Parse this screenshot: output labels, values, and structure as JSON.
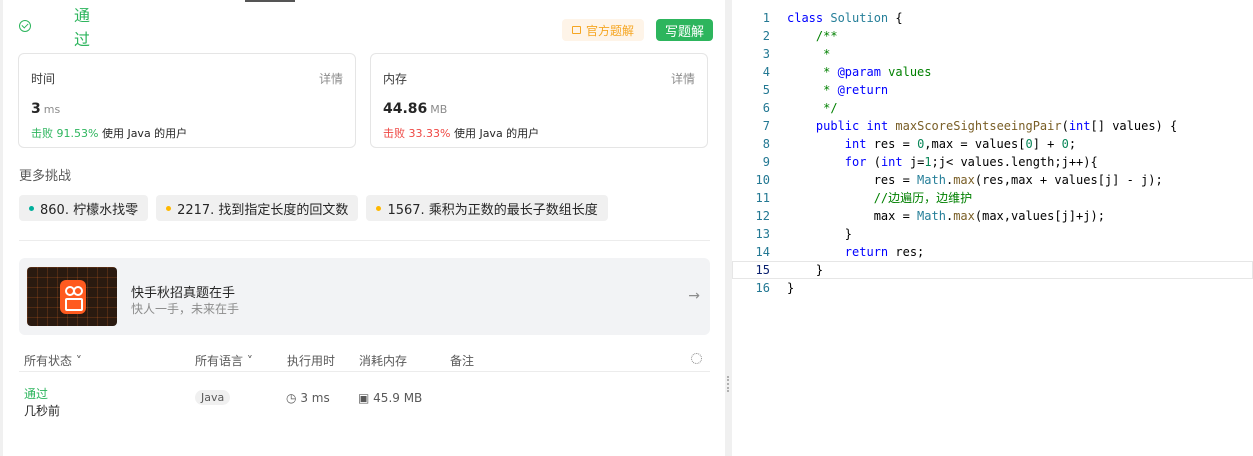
{
  "result": {
    "status": "通过",
    "official_solution_label": "官方题解",
    "write_solution_label": "写题解"
  },
  "time_card": {
    "label": "时间",
    "detail": "详情",
    "value": "3",
    "unit": "ms",
    "beat_pct": "击败 91.53%",
    "beat_suffix": "使用 Java 的用户"
  },
  "memory_card": {
    "label": "内存",
    "detail": "详情",
    "value": "44.86",
    "unit": "MB",
    "beat_pct": "击败 33.33%",
    "beat_suffix": "使用 Java 的用户"
  },
  "more_challenges": {
    "title": "更多挑战",
    "items": [
      {
        "label": "860. 柠檬水找零",
        "dot_color": "#00af9b"
      },
      {
        "label": "2217. 找到指定长度的回文数",
        "dot_color": "#ffb800"
      },
      {
        "label": "1567. 乘积为正数的最长子数组长度",
        "dot_color": "#ffb800"
      }
    ]
  },
  "ad": {
    "title": "快手秋招真题在手",
    "subtitle": "快人一手，未来在手"
  },
  "table": {
    "headers": {
      "status": "所有状态",
      "language": "所有语言",
      "runtime": "执行用时",
      "memory": "消耗内存",
      "notes": "备注"
    },
    "row": {
      "status": "通过",
      "time_ago": "几秒前",
      "language": "Java",
      "runtime": "3 ms",
      "memory": "45.9 MB"
    }
  },
  "code": {
    "current_line": 15,
    "lines": [
      "class Solution {",
      "    /**",
      "     *",
      "     * @param values",
      "     * @return",
      "     */",
      "    public int maxScoreSightseeingPair(int[] values) {",
      "        int res = 0,max = values[0] + 0;",
      "        for (int j=1;j< values.length;j++){",
      "            res = Math.max(res,max + values[j] - j);",
      "            //边遍历，边维护",
      "            max = Math.max(max,values[j]+j);",
      "        }",
      "        return res;",
      "    }",
      "}"
    ]
  }
}
